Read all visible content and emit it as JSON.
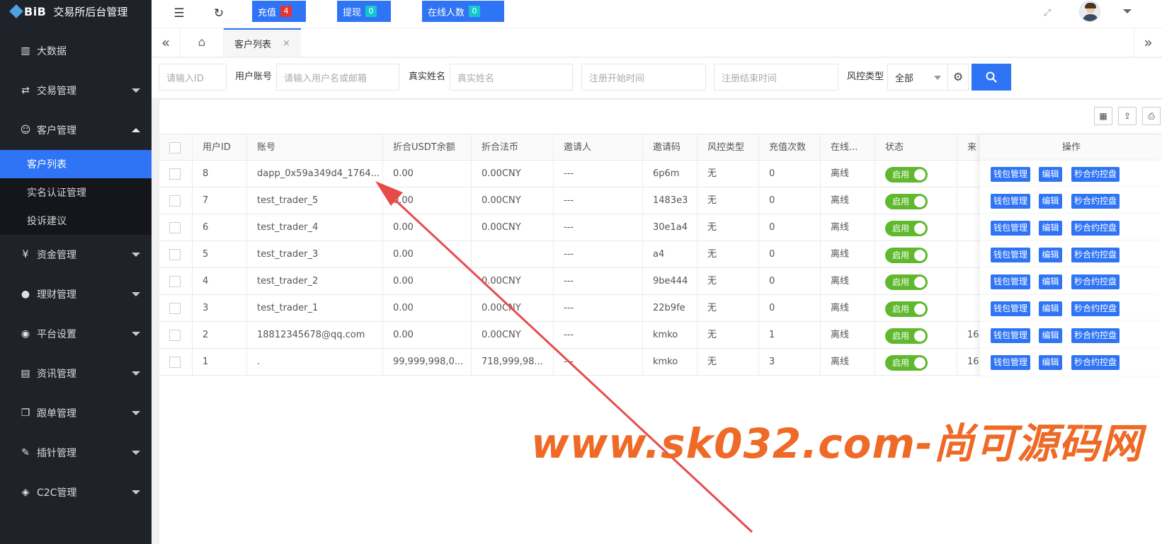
{
  "app": {
    "logo_text": "BiB",
    "title": "交易所后台管理"
  },
  "sidebar": {
    "items": [
      {
        "label": "大数据",
        "icon": "bar-chart-icon"
      },
      {
        "label": "交易管理",
        "icon": "exchange-icon"
      },
      {
        "label": "客户管理",
        "icon": "users-icon"
      },
      {
        "label": "资金管理",
        "icon": "money-bag-icon"
      },
      {
        "label": "理财管理",
        "icon": "piggy-bank-icon"
      },
      {
        "label": "平台设置",
        "icon": "settings-circle-icon"
      },
      {
        "label": "资讯管理",
        "icon": "news-icon"
      },
      {
        "label": "跟单管理",
        "icon": "copy-doc-icon"
      },
      {
        "label": "插针管理",
        "icon": "wrench-icon"
      },
      {
        "label": "C2C管理",
        "icon": "c2c-icon"
      }
    ],
    "sub_items": [
      {
        "label": "客户列表",
        "active": true
      },
      {
        "label": "实名认证管理"
      },
      {
        "label": "投诉建议"
      }
    ]
  },
  "header": {
    "recharge_label": "充值",
    "recharge_count": "4",
    "withdraw_label": "提现",
    "withdraw_count": "0",
    "online_label": "在线人数",
    "online_count": "0",
    "accent": "#2f74f5"
  },
  "tabs": {
    "current_label": "客户列表",
    "close_glyph": "×"
  },
  "filters": {
    "id_placeholder": "请输入ID",
    "account_label": "用户账号",
    "account_placeholder": "请输入用户名或邮箱",
    "realname_label": "真实姓名",
    "realname_placeholder": "真实姓名",
    "start_placeholder": "注册开始时间",
    "end_placeholder": "注册结束时间",
    "risk_label": "风控类型",
    "risk_value": "全部"
  },
  "table": {
    "headers": [
      "用户ID",
      "账号",
      "折合USDT余额",
      "折合法币",
      "邀请人",
      "邀请码",
      "风控类型",
      "充值次数",
      "在线...",
      "状态",
      "来"
    ],
    "ops_header": "操作",
    "status_label": "启用",
    "op_wallet": "钱包管理",
    "op_edit": "编辑",
    "op_risk": "秒合约控盘",
    "rows": [
      {
        "id": "8",
        "account": "dapp_0x59a349d4_1764...",
        "usdt": "0.00",
        "fiat": "0.00CNY",
        "inviter": "---",
        "code": "6p6m",
        "risk": "无",
        "recharges": "0",
        "online": "离线",
        "src": ""
      },
      {
        "id": "7",
        "account": "test_trader_5",
        "usdt": "0.00",
        "fiat": "0.00CNY",
        "inviter": "---",
        "code": "1483e3",
        "risk": "无",
        "recharges": "0",
        "online": "离线",
        "src": ""
      },
      {
        "id": "6",
        "account": "test_trader_4",
        "usdt": "0.00",
        "fiat": "0.00CNY",
        "inviter": "---",
        "code": "30e1a4",
        "risk": "无",
        "recharges": "0",
        "online": "离线",
        "src": ""
      },
      {
        "id": "5",
        "account": "test_trader_3",
        "usdt": "0.00",
        "fiat": "",
        "inviter": "---",
        "code": "a4",
        "risk": "无",
        "recharges": "0",
        "online": "离线",
        "src": ""
      },
      {
        "id": "4",
        "account": "test_trader_2",
        "usdt": "0.00",
        "fiat": "0.00CNY",
        "inviter": "---",
        "code": "9be444",
        "risk": "无",
        "recharges": "0",
        "online": "离线",
        "src": ""
      },
      {
        "id": "3",
        "account": "test_trader_1",
        "usdt": "0.00",
        "fiat": "0.00CNY",
        "inviter": "---",
        "code": "22b9fe",
        "risk": "无",
        "recharges": "0",
        "online": "离线",
        "src": ""
      },
      {
        "id": "2",
        "account": "18812345678@qq.com",
        "usdt": "0.00",
        "fiat": "0.00CNY",
        "inviter": "---",
        "code": "kmko",
        "risk": "无",
        "recharges": "1",
        "online": "离线",
        "src": "16"
      },
      {
        "id": "1",
        "account": ".",
        "usdt": "99,999,998,0...",
        "fiat": "718,999,98...",
        "inviter": "---",
        "code": "kmko",
        "risk": "无",
        "recharges": "3",
        "online": "离线",
        "src": "16"
      }
    ]
  },
  "watermark": {
    "text": "www.sk032.com-尚可源码网",
    "color": "#ee6a26"
  },
  "annotation": {
    "arrow_color": "#e84a4a"
  }
}
